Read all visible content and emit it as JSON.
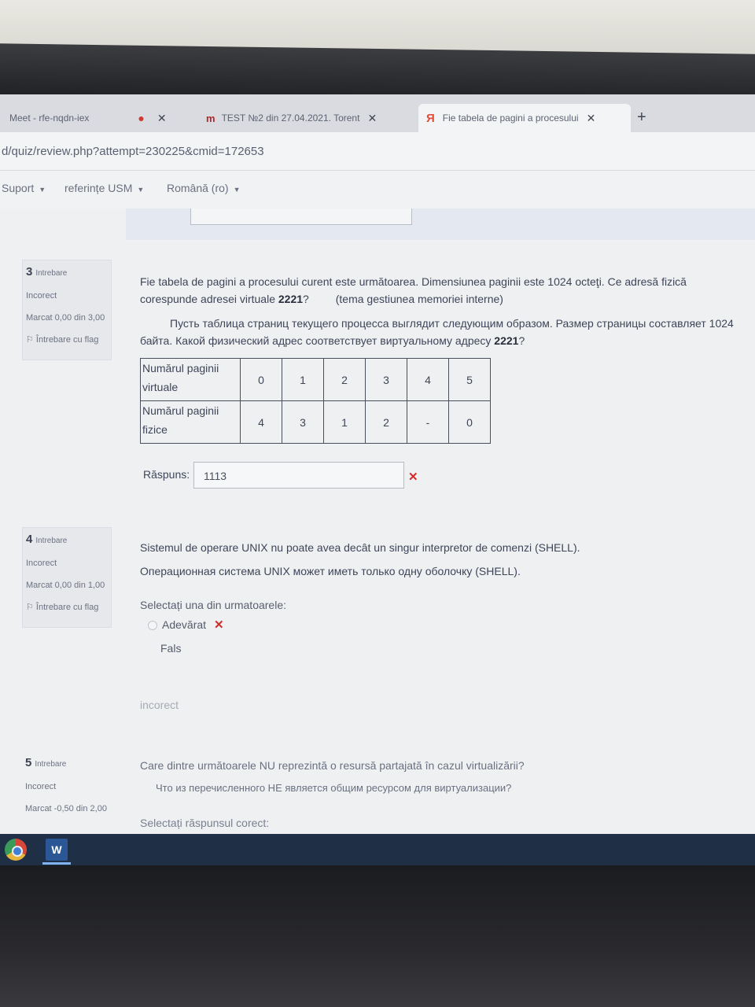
{
  "browser": {
    "tabs": [
      {
        "label": "Meet - rfe-nqdn-iex"
      },
      {
        "label": "TEST №2 din 27.04.2021. Torent"
      },
      {
        "label": "Fie tabela de pagini a procesului"
      }
    ],
    "close_glyph": "✕",
    "new_tab_glyph": "+",
    "url": "d/quiz/review.php?attempt=230225&cmid=172653"
  },
  "site_nav": {
    "items": [
      {
        "label": "Suport"
      },
      {
        "label": "referințe USM"
      },
      {
        "label": "Română (ro)"
      }
    ]
  },
  "questions": [
    {
      "number": "3",
      "label": "Intrebare",
      "status": "Incorect",
      "mark": "Marcat 0,00 din 3,00",
      "flag": "Întrebare cu flag",
      "text_ro": "Fie tabela de pagini a procesului curent este următoarea. Dimensiunea paginii este 1024 octeţi. Ce adresă fizică corespunde adresei virtuale",
      "text_ro_value": "2221",
      "text_ro_suffix": "?",
      "text_ro_topic": "(tema gestiunea memoriei interne)",
      "text_ru": "Пусть таблица страниц текущего процесса выглядит следующим образом. Размер страницы составляет 1024 байта. Какой физический адрес соответствует виртуальному адресу",
      "text_ru_value": "2221",
      "text_ru_suffix": "?",
      "table": {
        "row1_header": "Numărul paginii virtuale",
        "row1": [
          "0",
          "1",
          "2",
          "3",
          "4",
          "5"
        ],
        "row2_header": "Numărul paginii fizice",
        "row2": [
          "4",
          "3",
          "1",
          "2",
          "-",
          "0"
        ]
      },
      "answer_label": "Răspuns:",
      "answer_value": "1113"
    },
    {
      "number": "4",
      "label": "Intrebare",
      "status": "Incorect",
      "mark": "Marcat 0,00 din 1,00",
      "flag": "Întrebare cu flag",
      "text_ro": "Sistemul de operare UNIX nu poate avea decât un singur interpretor de comenzi (SHELL).",
      "text_ru": "Операционная система UNIX может иметь только одну оболочку (SHELL).",
      "prompt": "Selectați una din urmatoarele:",
      "options": [
        {
          "label": "Adevărat"
        },
        {
          "label": "Fals"
        }
      ],
      "feedback": "incorect"
    },
    {
      "number": "5",
      "label": "Intrebare",
      "status": "Incorect",
      "mark": "Marcat -0,50 din 2,00",
      "text_ro": "Care dintre următoarele NU reprezintă o resursă partajată în cazul virtualizării?",
      "text_ru": "Что из перечисленного НЕ является общим ресурсом для виртуализации?",
      "prompt": "Selectați răspunsul corect:"
    }
  ],
  "taskbar": {
    "apps": [
      {
        "icon": "chrome-icon"
      },
      {
        "icon": "word-icon",
        "glyph": "W"
      }
    ]
  },
  "colors": {
    "incorrect_mark": "#d32b2b",
    "taskbar": "#1f3046"
  }
}
